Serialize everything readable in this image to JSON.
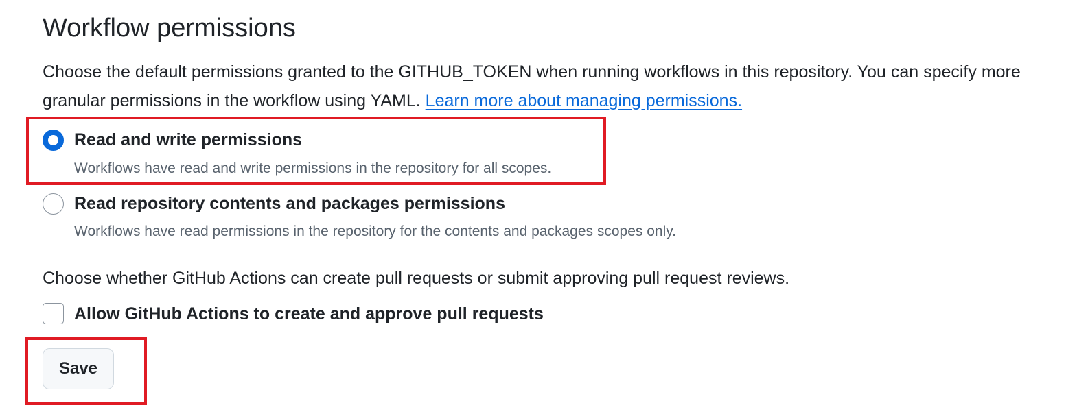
{
  "section": {
    "title": "Workflow permissions",
    "description": "Choose the default permissions granted to the GITHUB_TOKEN when running workflows in this repository. You can specify more granular permissions in the workflow using YAML.",
    "learn_more_link": "Learn more about managing permissions."
  },
  "options": [
    {
      "label": "Read and write permissions",
      "note": "Workflows have read and write permissions in the repository for all scopes.",
      "selected": true
    },
    {
      "label": "Read repository contents and packages permissions",
      "note": "Workflows have read permissions in the repository for the contents and packages scopes only.",
      "selected": false
    }
  ],
  "pull_requests": {
    "description": "Choose whether GitHub Actions can create pull requests or submit approving pull request reviews.",
    "checkbox_label": "Allow GitHub Actions to create and approve pull requests",
    "checked": false
  },
  "actions": {
    "save_label": "Save"
  },
  "colors": {
    "accent": "#0969da",
    "highlight": "#e01b24",
    "text": "#1f2328",
    "muted": "#59636e"
  }
}
